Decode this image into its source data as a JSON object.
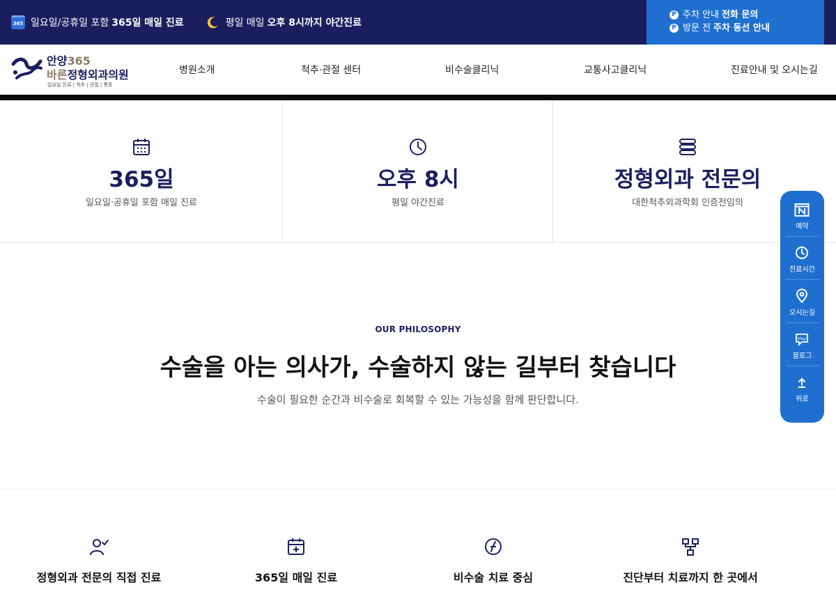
{
  "topbar": {
    "left": [
      {
        "icon": "calendar-365-icon",
        "badge": "365",
        "pre": "일요일/공휴일 포함",
        "bold": "365일 매일 진료",
        "post": ""
      },
      {
        "icon": "moon-icon",
        "pre": "평일 매일",
        "bold": "오후 8시까지 야간진료",
        "post": ""
      }
    ],
    "right": [
      {
        "badge": "P",
        "pre": "주차 안내",
        "bold": "전화 문의"
      },
      {
        "badge": "P",
        "pre": "방문 전",
        "bold": "주차 동선 안내"
      }
    ],
    "accent": "#1b1e5e",
    "blue": "#1f6fd1"
  },
  "logo": {
    "line1_a": "안양",
    "line1_b": "365",
    "line2_a": "바른",
    "line2_b": "정형외과의원",
    "tagline": "일요일 진료 | 척추 | 관절 | 통증"
  },
  "nav": [
    "병원소개",
    "척추·관절 센터",
    "비수술클리닉",
    "교통사고클리닉",
    "진료안내 및 오시는길"
  ],
  "stats": [
    {
      "icon": "calendar-icon",
      "big": "365일",
      "sub": "일요일·공휴일 포함 매일 진료"
    },
    {
      "icon": "clock-icon",
      "big": "오후 8시",
      "sub": "평일 야간진료"
    },
    {
      "icon": "stack-icon",
      "big": "정형외과 전문의",
      "sub": "대한척추외과학회 인증전임의"
    }
  ],
  "philosophy": {
    "eyebrow": "OUR PHILOSOPHY",
    "title": "수술을 아는 의사가, 수술하지 않는 길부터 찾습니다",
    "subtitle": "수술이 필요한 순간과 비수술로 회복할 수 있는 가능성을 함께 판단합니다."
  },
  "features": [
    {
      "icon": "doctor-check-icon",
      "label": "정형외과 전문의 직접 진료"
    },
    {
      "icon": "calendar-plus-icon",
      "label": "365일 매일 진료"
    },
    {
      "icon": "compass-icon",
      "label": "비수술 치료 중심"
    },
    {
      "icon": "flow-icon",
      "label": "진단부터 치료까지 한 곳에서"
    }
  ],
  "quick_menu": [
    {
      "icon": "naver-icon",
      "label": "예약"
    },
    {
      "icon": "clock-icon",
      "label": "진료시간"
    },
    {
      "icon": "location-pin-icon",
      "label": "오시는길"
    },
    {
      "icon": "blog-icon",
      "label": "블로그"
    },
    {
      "icon": "arrow-up-icon",
      "label": "위로"
    }
  ]
}
